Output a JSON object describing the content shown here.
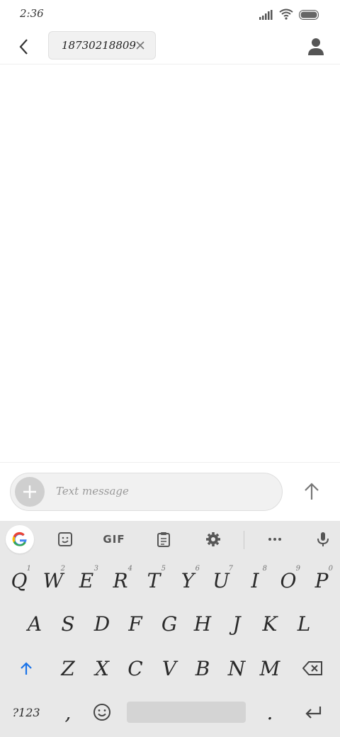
{
  "status_bar": {
    "time": "2:36"
  },
  "header": {
    "recipient": "18730218809"
  },
  "composer": {
    "placeholder": "Text message"
  },
  "keyboard": {
    "toolbar": {
      "gif_label": "GIF"
    },
    "row1": [
      {
        "label": "Q",
        "hint": "1"
      },
      {
        "label": "W",
        "hint": "2"
      },
      {
        "label": "E",
        "hint": "3"
      },
      {
        "label": "R",
        "hint": "4"
      },
      {
        "label": "T",
        "hint": "5"
      },
      {
        "label": "Y",
        "hint": "6"
      },
      {
        "label": "U",
        "hint": "7"
      },
      {
        "label": "I",
        "hint": "8"
      },
      {
        "label": "O",
        "hint": "9"
      },
      {
        "label": "P",
        "hint": "0"
      }
    ],
    "row2": [
      "A",
      "S",
      "D",
      "F",
      "G",
      "H",
      "J",
      "K",
      "L"
    ],
    "row3": [
      "Z",
      "X",
      "C",
      "V",
      "B",
      "N",
      "M"
    ],
    "bottom": {
      "symbols": "?123",
      "comma": ",",
      "period": "."
    }
  },
  "colors": {
    "accent": "#1a73e8",
    "keyboard_bg": "#e8e8e8"
  }
}
